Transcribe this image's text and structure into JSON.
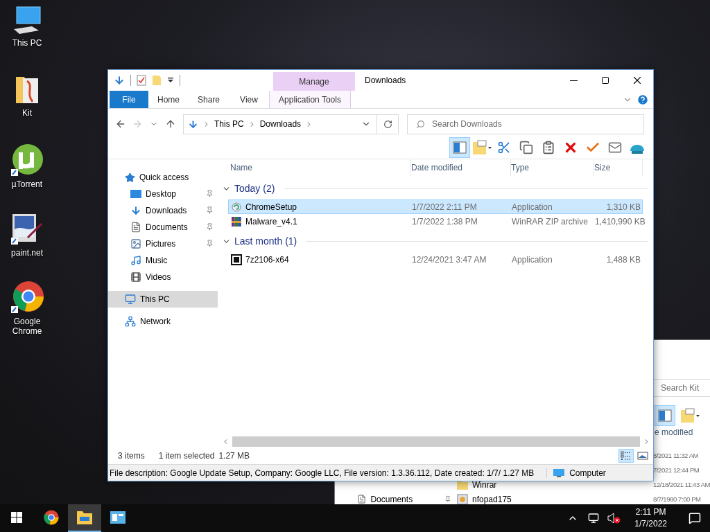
{
  "desktop_icons": [
    {
      "label": "This PC",
      "kind": "pc"
    },
    {
      "label": "Kit",
      "kind": "folder"
    },
    {
      "label": "µTorrent",
      "kind": "torrent"
    },
    {
      "label": "paint.net",
      "kind": "paint"
    },
    {
      "label": "Google Chrome",
      "kind": "chrome"
    }
  ],
  "back_window": {
    "search": {
      "placeholder": "Search Kit"
    },
    "toolbar": [
      {
        "kind": "preview-pane",
        "selected": true
      },
      {
        "kind": "properties",
        "selected": false
      }
    ],
    "column": "e modified",
    "nav": [
      {
        "label": "Documents",
        "pinned": true
      }
    ],
    "rows": [
      {
        "date": "8/2021 11:32 AM"
      },
      {
        "date": "7/2021 12:44 PM"
      },
      {
        "name": "Winrar",
        "kind": "folder",
        "date": "12/18/2021 11:43 AM"
      },
      {
        "name": "nfopad175",
        "kind": "app",
        "date": "8/7/1980 7:00 PM"
      }
    ]
  },
  "window": {
    "title": "Downloads",
    "context_group": "Manage",
    "ribbon_tabs": [
      {
        "label": "File",
        "kind": "file"
      },
      {
        "label": "Home",
        "kind": "plain"
      },
      {
        "label": "Share",
        "kind": "plain"
      },
      {
        "label": "View",
        "kind": "plain"
      },
      {
        "label": "Application Tools",
        "kind": "context"
      }
    ],
    "address": [
      "This PC",
      "Downloads"
    ],
    "search": {
      "placeholder": "Search Downloads"
    },
    "toolbar": [
      {
        "kind": "preview-pane",
        "selected": true
      },
      {
        "kind": "properties",
        "selected": false
      },
      {
        "kind": "cut",
        "selected": false
      },
      {
        "kind": "copy",
        "selected": false
      },
      {
        "kind": "paste",
        "selected": false
      },
      {
        "kind": "delete",
        "selected": false
      },
      {
        "kind": "check",
        "selected": false
      },
      {
        "kind": "rename",
        "selected": false
      },
      {
        "kind": "shell",
        "selected": false
      }
    ],
    "nav": [
      {
        "label": "Quick access",
        "kind": "star",
        "selected": false,
        "children": [
          {
            "label": "Desktop",
            "kind": "desktop",
            "pinned": true,
            "selected": false
          },
          {
            "label": "Downloads",
            "kind": "downloads",
            "pinned": true,
            "selected": false
          },
          {
            "label": "Documents",
            "kind": "documents",
            "pinned": true,
            "selected": false
          },
          {
            "label": "Pictures",
            "kind": "pictures",
            "pinned": true,
            "selected": false
          },
          {
            "label": "Music",
            "kind": "music",
            "pinned": false,
            "selected": false
          },
          {
            "label": "Videos",
            "kind": "videos",
            "pinned": false,
            "selected": false
          }
        ]
      },
      {
        "label": "This PC",
        "kind": "pc",
        "selected": true
      },
      {
        "label": "Network",
        "kind": "network",
        "selected": false
      }
    ],
    "columns": [
      "Name",
      "Date modified",
      "Type",
      "Size"
    ],
    "groups": [
      {
        "label": "Today (2)",
        "expanded": true,
        "files": [
          {
            "name": "ChromeSetup",
            "kind": "setup",
            "date": "1/7/2022 2:11 PM",
            "type": "Application",
            "size": "1,310 KB",
            "selected": true
          },
          {
            "name": "Malware_v4.1",
            "kind": "rar",
            "date": "1/7/2022 1:38 PM",
            "type": "WinRAR ZIP archive",
            "size": "1,410,990 KB",
            "selected": false
          }
        ]
      },
      {
        "label": "Last month (1)",
        "expanded": true,
        "files": [
          {
            "name": "7z2106-x64",
            "kind": "sevenzip",
            "date": "12/24/2021 3:47 AM",
            "type": "Application",
            "size": "1,488 KB",
            "selected": false
          }
        ]
      }
    ],
    "status": {
      "count": "3 items",
      "selection": "1 item selected",
      "size": "1.27 MB"
    },
    "views": [
      {
        "kind": "details",
        "selected": true
      },
      {
        "kind": "large-icons",
        "selected": false
      }
    ],
    "details_bar": {
      "description": "File description: Google Update Setup, Company: Google LLC, File version: 1.3.36.112, Date created: 1/7/",
      "size": "1.27 MB",
      "location": "Computer"
    }
  },
  "taskbar": {
    "apps": [
      {
        "kind": "chrome",
        "active": false
      },
      {
        "kind": "explorer",
        "active": true
      },
      {
        "kind": "app",
        "active": false
      }
    ],
    "time": "2:11 PM",
    "date": "1/7/2022"
  }
}
